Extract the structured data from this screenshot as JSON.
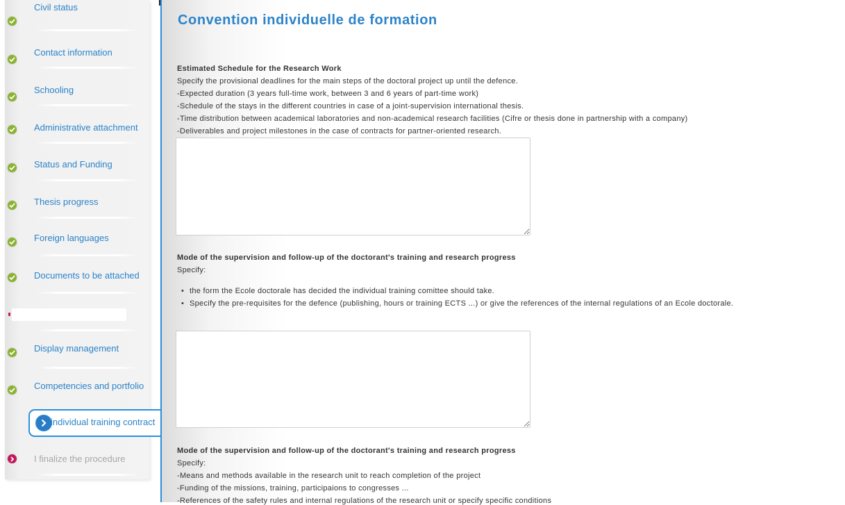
{
  "sidebar": {
    "steps": [
      {
        "label": "Civil status",
        "status": "done"
      },
      {
        "label": "Contact information",
        "status": "done"
      },
      {
        "label": "Schooling",
        "status": "done"
      },
      {
        "label": "Administrative attachment",
        "status": "done"
      },
      {
        "label": "Status and Funding",
        "status": "done"
      },
      {
        "label": "Thesis progress",
        "status": "done"
      },
      {
        "label": "Foreign languages",
        "status": "done"
      },
      {
        "label": "Documents to be attached",
        "status": "done"
      },
      {
        "label": "",
        "status": "blank"
      },
      {
        "label": "Display management",
        "status": "done"
      },
      {
        "label": "Competencies and portfolio",
        "status": "done"
      }
    ],
    "active_step": {
      "label": "individual training contract"
    },
    "last_step": {
      "label": "I finalize the procedure",
      "status": "pending"
    }
  },
  "main": {
    "title": "Convention individuelle de formation",
    "section1": {
      "title": "Estimated Schedule for the Research Work",
      "lines": [
        "Specify the provisional deadlines for the main steps of the doctoral project up until the defence.",
        "-Expected duration (3 years full-time work, between 3 and 6 years of part-time work)",
        "-Schedule of the stays in the different countries in case of a joint-supervision international thesis.",
        "-Time distribution between academical laboratories and non-academical research facilities (Cifre or thesis done in partnership with a company)",
        "-Deliverables and project milestones in the case of contracts for partner-oriented research."
      ],
      "value": ""
    },
    "section2": {
      "title": "Mode of the supervision and follow-up of the doctorant's training and research progress",
      "intro": "Specify:",
      "bullets": [
        "the form the Ecole doctorale has decided the individual training comittee should take.",
        "Specify the pre-requisites for the defence (publishing, hours or training ECTS ...) or give the references of the internal regulations of an Ecole doctorale."
      ],
      "value": ""
    },
    "section3": {
      "title": "Mode of the supervision and follow-up of the doctorant's training and research progress",
      "intro": "Specify:",
      "lines": [
        "-Means and methods available in the research unit to reach completion of the project",
        "-Funding of the missions, training, participaions to congresses ...",
        "-References of the safety rules and internal regulations of the research unit or specify specific conditions"
      ]
    }
  },
  "colors": {
    "accent": "#2b83c9",
    "done": "#8bb232",
    "pending": "#c4175d"
  }
}
